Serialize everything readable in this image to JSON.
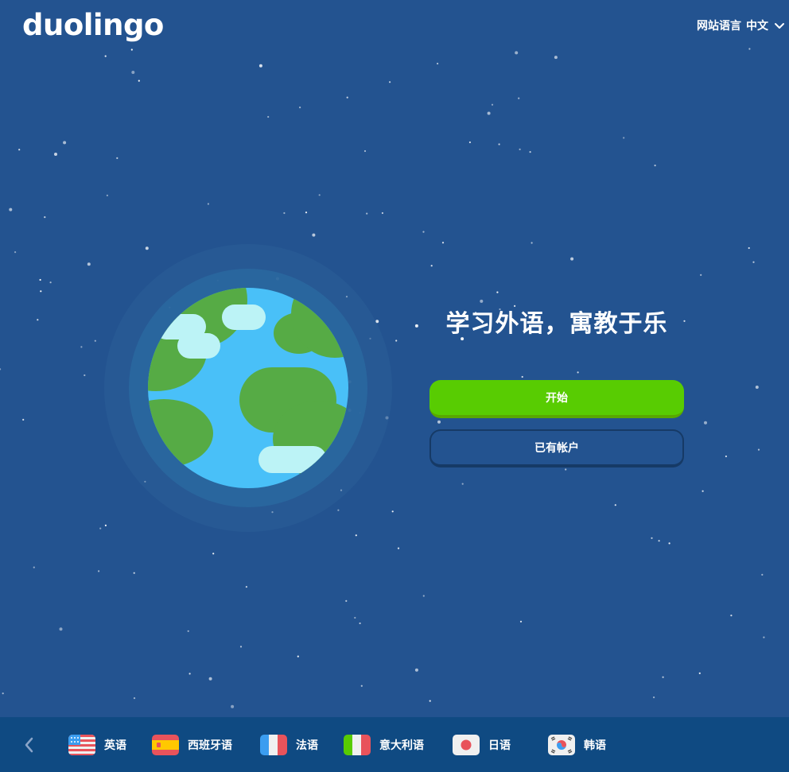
{
  "brand": {
    "logo_text": "duolingo"
  },
  "header": {
    "site_language_label": "网站语言",
    "site_language_value": "中文"
  },
  "hero": {
    "headline": "学习外语，寓教于乐",
    "primary_button": "开始",
    "secondary_button": "已有帐户"
  },
  "courses": [
    {
      "label": "英语",
      "flag_icon": "us-flag-icon"
    },
    {
      "label": "西班牙语",
      "flag_icon": "spain-flag-icon"
    },
    {
      "label": "法语",
      "flag_icon": "france-flag-icon"
    },
    {
      "label": "意大利语",
      "flag_icon": "italy-flag-icon"
    },
    {
      "label": "日语",
      "flag_icon": "japan-flag-icon"
    },
    {
      "label": "韩语",
      "flag_icon": "korea-flag-icon"
    }
  ],
  "colors": {
    "background": "#235390",
    "primary_green": "#58cc02",
    "bottom_bar": "#0f4a82",
    "ocean": "#49c0f8",
    "land": "#56ab45",
    "cloud": "#bcf3f6"
  }
}
